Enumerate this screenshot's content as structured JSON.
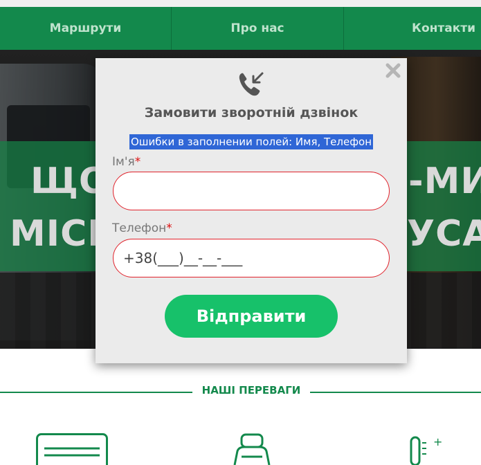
{
  "nav": {
    "items": [
      {
        "label": "Маршрути"
      },
      {
        "label": "Про нас"
      },
      {
        "label": "Контакти"
      }
    ]
  },
  "hero": {
    "line1_left": "ЩО",
    "line2_left": "МІСЦ",
    "line1_right": "-МИ",
    "line2_right": "УСА"
  },
  "advantages": {
    "title": "НАШІ ПЕРЕВАГИ",
    "icons": [
      "air-conditioner-icon",
      "seat-icon",
      "thermometer-icon"
    ]
  },
  "modal": {
    "title": "Замовити зворотній дзвінок",
    "error": "Ошибки в заполнении полей: Имя, Телефон",
    "name_label": "Ім'я",
    "phone_label": "Телефон",
    "required_mark": "*",
    "name_value": "",
    "phone_value": "+38(___)__-__-___",
    "submit_label": "Відправити"
  },
  "colors": {
    "brand_green": "#13894c",
    "button_green": "#17c16a",
    "error_highlight": "#2f66d6",
    "field_border": "#e0222b"
  }
}
